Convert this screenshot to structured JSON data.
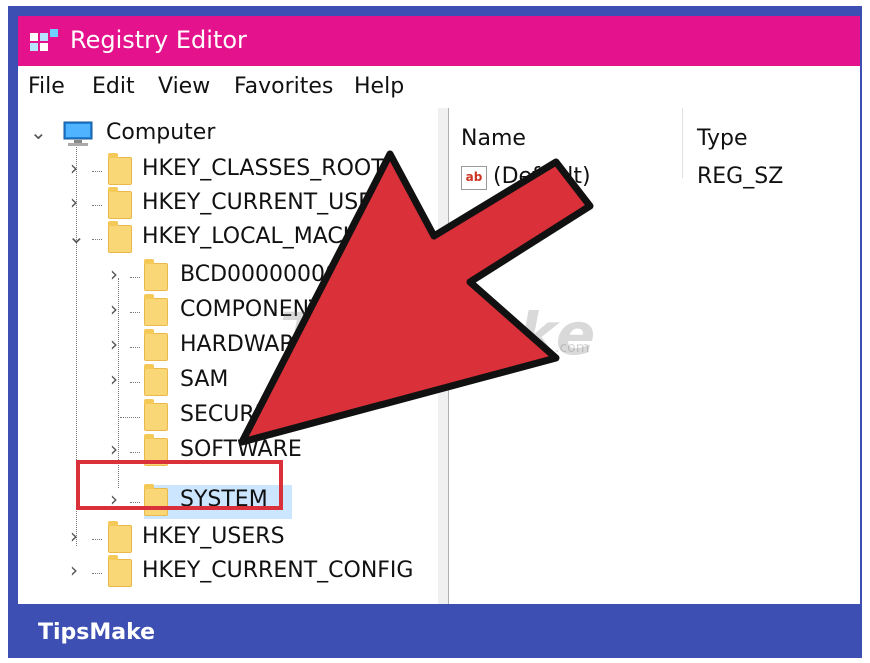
{
  "window": {
    "title": "Registry Editor"
  },
  "menu": [
    "File",
    "Edit",
    "View",
    "Favorites",
    "Help"
  ],
  "tree": {
    "root": "Computer",
    "hkeys_top": [
      "HKEY_CLASSES_ROOT",
      "HKEY_CURRENT_USER",
      "HKEY_LOCAL_MACHINE"
    ],
    "hklm_children": [
      "BCD00000000",
      "COMPONENTS",
      "HARDWARE",
      "SAM",
      "SECURITY",
      "SOFTWARE",
      "SYSTEM"
    ],
    "hkeys_bottom": [
      "HKEY_USERS",
      "HKEY_CURRENT_CONFIG"
    ],
    "selected": "SYSTEM"
  },
  "list": {
    "columns": [
      "Name",
      "Type"
    ],
    "rows": [
      {
        "name": "(Default)",
        "type": "REG_SZ",
        "icon": "ab"
      }
    ]
  },
  "watermark": "TipsMake",
  "footer": {
    "brand": "TipsMake"
  },
  "colors": {
    "titlebar": "#e4128c",
    "frame": "#3d4fb3",
    "arrow": "#d9303a",
    "selection": "#cce6ff"
  },
  "icons": [
    "registry-app-icon",
    "computer-icon",
    "folder-icon",
    "chevron-right-icon",
    "chevron-down-icon",
    "string-value-icon"
  ]
}
